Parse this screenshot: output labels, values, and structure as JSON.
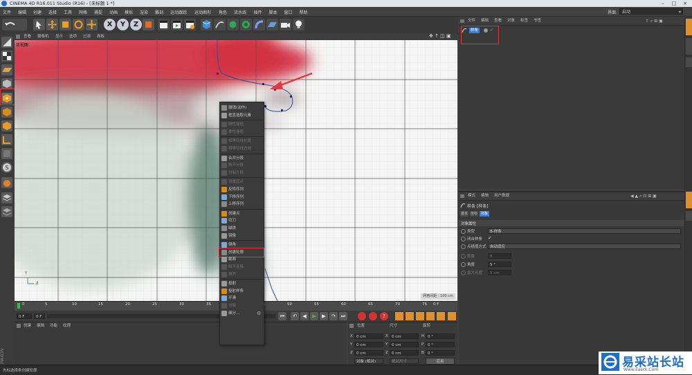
{
  "window": {
    "title": "CINEMA 4D R16.011 Studio (R16) - [未标题 1 *]"
  },
  "menubar": {
    "items": [
      "文件",
      "编辑",
      "创建",
      "选择",
      "工具",
      "网格",
      "捕捉",
      "动画",
      "模拟",
      "渲染",
      "雕刻",
      "运动跟踪",
      "运动图形",
      "角色",
      "流水线",
      "插件",
      "脚本",
      "窗口",
      "帮助"
    ],
    "layout_label": "界面:",
    "layout_value": "启动"
  },
  "viewport": {
    "menu": [
      "查看",
      "摄像机",
      "显示",
      "选项",
      "过滤",
      "面板"
    ],
    "view_name": "正视图",
    "axis_y": "Y",
    "axis_z": "Z",
    "grid_distance": "网格间距 : 100 cm"
  },
  "context_menu": {
    "items": [
      {
        "label": "撤销(动作)",
        "enabled": true,
        "icon": "undo-icon"
      },
      {
        "label": "框显选取元素",
        "enabled": true,
        "icon": "frame-selection-icon"
      },
      {
        "sep": true
      },
      {
        "label": "刚性插值",
        "enabled": false,
        "icon": "hard-interpolation-icon"
      },
      {
        "label": "柔性插值",
        "enabled": false,
        "icon": "soft-interpolation-icon"
      },
      {
        "sep": true
      },
      {
        "label": "相等切线长度",
        "enabled": false,
        "icon": "equal-tangent-length-icon"
      },
      {
        "label": "相等切线方向",
        "enabled": false,
        "icon": "equal-tangent-direction-icon"
      },
      {
        "sep": true
      },
      {
        "label": "合并分段",
        "enabled": true,
        "icon": "join-segment-icon"
      },
      {
        "label": "断开分段",
        "enabled": false,
        "icon": "break-segment-icon"
      },
      {
        "label": "分裂片段",
        "enabled": false,
        "icon": "explode-segments-icon"
      },
      {
        "sep": true
      },
      {
        "label": "设置起点",
        "enabled": false,
        "icon": "set-first-point-icon"
      },
      {
        "label": "反转序列",
        "enabled": true,
        "icon": "reverse-sequence-icon"
      },
      {
        "label": "下移序列",
        "enabled": true,
        "icon": "move-down-sequence-icon"
      },
      {
        "label": "上移序列",
        "enabled": true,
        "icon": "move-up-sequence-icon"
      },
      {
        "sep": true
      },
      {
        "label": "创建点",
        "enabled": true,
        "icon": "create-point-icon"
      },
      {
        "label": "切刀",
        "enabled": true,
        "icon": "knife-icon"
      },
      {
        "label": "磁铁",
        "enabled": true,
        "icon": "magnet-icon"
      },
      {
        "label": "镜像",
        "enabled": true,
        "icon": "mirror-icon"
      },
      {
        "sep": true
      },
      {
        "label": "倒角",
        "enabled": true,
        "icon": "chamfer-icon"
      },
      {
        "label": "创建轮廓",
        "enabled": true,
        "icon": "create-outline-icon",
        "highlight": true
      },
      {
        "label": "截面",
        "enabled": true,
        "icon": "cross-section-icon"
      },
      {
        "label": "断开连接",
        "enabled": false,
        "icon": "disconnect-icon"
      },
      {
        "label": "排齐",
        "enabled": false,
        "icon": "line-up-icon"
      },
      {
        "sep": true
      },
      {
        "label": "投射",
        "enabled": true,
        "icon": "project-icon"
      },
      {
        "label": "投射样条",
        "enabled": true,
        "icon": "project-spline-icon"
      },
      {
        "label": "平滑",
        "enabled": true,
        "icon": "smooth-icon"
      },
      {
        "label": "分裂",
        "enabled": false,
        "icon": "split-icon"
      },
      {
        "label": "细分...",
        "enabled": true,
        "icon": "subdivide-icon"
      }
    ]
  },
  "timeline": {
    "ticks": [
      "0",
      "5",
      "10",
      "15",
      "20",
      "25",
      "30",
      "35",
      "40",
      "45",
      "50",
      "55",
      "60",
      "65",
      "70",
      "75"
    ],
    "current_frame": "0 F",
    "start_field": "0 F",
    "start_field_right": "0 F"
  },
  "material_panel": {
    "menu": [
      "创建",
      "编辑",
      "功能",
      "纹理"
    ]
  },
  "coord_panel": {
    "headers": [
      "位置",
      "尺寸",
      "旋转"
    ],
    "rows": [
      {
        "axis": "X",
        "pos": "0 cm",
        "size_axis": "X",
        "size": "0 cm",
        "rot_axis": "H",
        "rot": "0 °"
      },
      {
        "axis": "Y",
        "pos": "0 cm",
        "size_axis": "Y",
        "size": "0 cm",
        "rot_axis": "P",
        "rot": "0 °"
      },
      {
        "axis": "Z",
        "pos": "0 cm",
        "size_axis": "Z",
        "size": "0 cm",
        "rot_axis": "B",
        "rot": "0 °"
      }
    ],
    "mode_label": "对象 (相对)",
    "size_mode": "绝对尺寸",
    "apply_button": "应用"
  },
  "object_manager": {
    "menu": [
      "文件",
      "编辑",
      "查看",
      "对象",
      "标签",
      "书签"
    ],
    "object_name": "样条"
  },
  "attribute_manager": {
    "menu": [
      "模式",
      "编辑",
      "用户数据"
    ],
    "object_title": "样条 [样条]",
    "tabs": [
      "基本",
      "坐标",
      "对象"
    ],
    "section_title": "对象属性",
    "type_label": "类型",
    "type_value": "B-样条",
    "close_label": "闭合样条",
    "close_checked": true,
    "interp_label": "点插值方式",
    "interp_value": "自动适应",
    "count_label": "数量",
    "count_value": "8",
    "angle_label": "角度",
    "angle_value": "5 °",
    "maxlen_label": "最大长度",
    "maxlen_value": "5 cm"
  },
  "statusbar": {
    "text": "先标选择条创建轮廓"
  },
  "watermark": {
    "cn": "易采站长站",
    "url": "Www.Easck.Com"
  },
  "colors": {
    "accent_orange": "#f0a020",
    "highlight_red": "#e23a3a",
    "brand_blue": "#1e6fc8",
    "selection_blue": "#3d7fd6"
  }
}
